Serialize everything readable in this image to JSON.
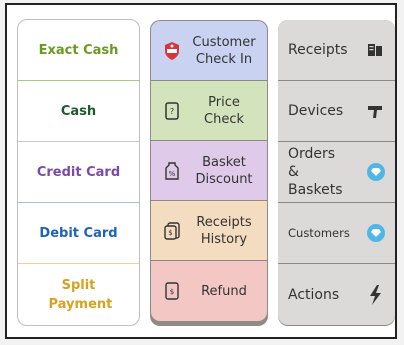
{
  "payment_buttons": [
    {
      "label": "Exact Cash",
      "color": "#6a9a1f"
    },
    {
      "label": "Cash",
      "color": "#1f5a2a"
    },
    {
      "label": "Credit Card",
      "color": "#7b4aa8"
    },
    {
      "label": "Debit Card",
      "color": "#1f63b8"
    },
    {
      "label": "Split Payment",
      "color": "#d7a21f"
    }
  ],
  "action_buttons": [
    {
      "label": "Customer Check In",
      "icon": "badge-icon"
    },
    {
      "label": "Price Check",
      "icon": "price-tag-icon"
    },
    {
      "label": "Basket Discount",
      "icon": "discount-tag-icon"
    },
    {
      "label": "Receipts History",
      "icon": "receipt-history-icon"
    },
    {
      "label": "Refund",
      "icon": "refund-icon"
    }
  ],
  "nav_buttons": [
    {
      "label": "Receipts",
      "icon": "receipt-printer-icon"
    },
    {
      "label": "Devices",
      "icon": "scanner-gun-icon"
    },
    {
      "label": "Orders & Baskets",
      "icon": "diamond-badge-icon"
    },
    {
      "label": "Customers",
      "icon": "diamond-badge-icon"
    },
    {
      "label": "Actions",
      "icon": "lightning-icon"
    }
  ],
  "colors": {
    "accent_diamond": "#4fb6e8",
    "badge_red": "#d8343a"
  }
}
